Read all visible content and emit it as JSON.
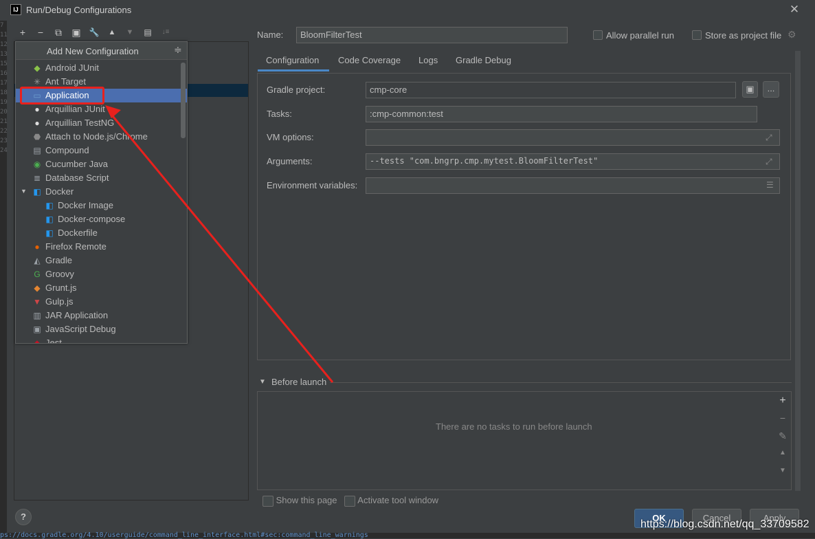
{
  "window": {
    "title": "Run/Debug Configurations",
    "app_icon": "IJ",
    "close": "✕"
  },
  "toolbar": {
    "add": "+",
    "remove": "−",
    "copy": "⧉",
    "save": "▣",
    "edit": "🔧",
    "up": "▲",
    "down": "▼",
    "folder": "▤",
    "sort": "↓≡"
  },
  "popup": {
    "title": "Add New Configuration",
    "items": [
      {
        "label": "Android JUnit",
        "icon": "android-icon",
        "color": "#8bc34a"
      },
      {
        "label": "Ant Target",
        "icon": "ant-icon",
        "color": "#999999"
      },
      {
        "label": "Application",
        "icon": "application-icon",
        "color": "#6e9ecf",
        "selected": true
      },
      {
        "label": "Arquillian JUnit",
        "icon": "arquillian-icon",
        "color": "#dddddd"
      },
      {
        "label": "Arquillian TestNG",
        "icon": "arquillian-icon",
        "color": "#dddddd"
      },
      {
        "label": "Attach to Node.js/Chrome",
        "icon": "nodejs-icon",
        "color": "#888888"
      },
      {
        "label": "Compound",
        "icon": "compound-icon",
        "color": "#9aa0a6"
      },
      {
        "label": "Cucumber Java",
        "icon": "cucumber-icon",
        "color": "#4caf50"
      },
      {
        "label": "Database Script",
        "icon": "database-icon",
        "color": "#9aa0a6"
      },
      {
        "label": "Docker",
        "icon": "docker-icon",
        "color": "#2496ed",
        "expanded": true
      },
      {
        "label": "Docker Image",
        "icon": "docker-icon",
        "color": "#2496ed",
        "child": true
      },
      {
        "label": "Docker-compose",
        "icon": "docker-icon",
        "color": "#2496ed",
        "child": true
      },
      {
        "label": "Dockerfile",
        "icon": "docker-icon",
        "color": "#2496ed",
        "child": true
      },
      {
        "label": "Firefox Remote",
        "icon": "firefox-icon",
        "color": "#e66000"
      },
      {
        "label": "Gradle",
        "icon": "gradle-icon",
        "color": "#9aa0a6"
      },
      {
        "label": "Groovy",
        "icon": "groovy-icon",
        "color": "#4caf50"
      },
      {
        "label": "Grunt.js",
        "icon": "grunt-icon",
        "color": "#e48632"
      },
      {
        "label": "Gulp.js",
        "icon": "gulp-icon",
        "color": "#cf4647"
      },
      {
        "label": "JAR Application",
        "icon": "jar-icon",
        "color": "#9aa0a6"
      },
      {
        "label": "JavaScript Debug",
        "icon": "js-debug-icon",
        "color": "#9aa0a6"
      },
      {
        "label": "Jest",
        "icon": "jest-icon",
        "color": "#c21325"
      }
    ]
  },
  "form": {
    "name_label": "Name:",
    "name_value": "BloomFilterTest",
    "allow_parallel": "Allow parallel run",
    "store_project": "Store as project file",
    "tabs": [
      "Configuration",
      "Code Coverage",
      "Logs",
      "Gradle Debug"
    ],
    "gradle_project_label": "Gradle project:",
    "gradle_project_value": "cmp-core",
    "browse_dots": "...",
    "tasks_label": "Tasks:",
    "tasks_value": ":cmp-common:test",
    "vm_label": "VM options:",
    "vm_value": "",
    "args_label": "Arguments:",
    "args_value": "--tests \"com.bngrp.cmp.mytest.BloomFilterTest\"",
    "env_label": "Environment variables:",
    "env_value": ""
  },
  "before_launch": {
    "title": "Before launch",
    "empty": "There are no tasks to run before launch",
    "show_page": "Show this page",
    "activate": "Activate tool window"
  },
  "buttons": {
    "ok": "OK",
    "cancel": "Cancel",
    "apply": "Apply",
    "help": "?"
  },
  "footer": {
    "url": "ps://docs.gradle.org/4.10/userguide/command_line_interface.html#sec:command_line_warnings",
    "watermark": "https://blog.csdn.net/qq_33709582"
  },
  "colors": {
    "accent": "#4b6eaf",
    "annotation": "#e8211d"
  }
}
